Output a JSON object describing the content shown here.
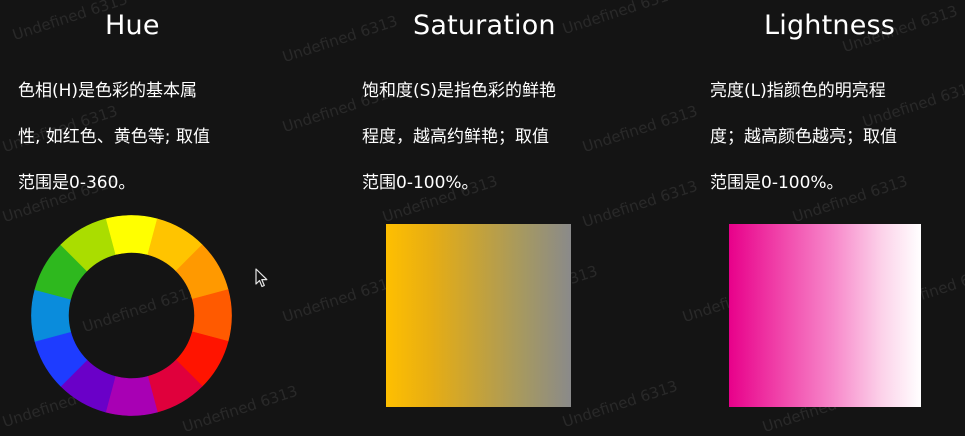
{
  "columns": {
    "hue": {
      "title": "Hue",
      "lines": [
        "色相(H)是色彩的基本属",
        "性, 如红色、黄色等; 取值",
        "范围是0-360。"
      ]
    },
    "saturation": {
      "title": "Saturation",
      "lines": [
        "饱和度(S)是指色彩的鲜艳",
        "程度，越高约鲜艳；取值",
        "范围0-100%。"
      ]
    },
    "lightness": {
      "title": "Lightness",
      "lines": [
        "亮度(L)指颜色的明亮程",
        "度；越高颜色越亮；取值",
        "范围是0-100%。"
      ]
    }
  },
  "hue_wheel": {
    "segment_colors": [
      "#ffff00",
      "#ffc400",
      "#ff9900",
      "#ff5a00",
      "#ff1400",
      "#e0003c",
      "#a800b4",
      "#6a00c8",
      "#1e3cff",
      "#0a8cdc",
      "#2eb81e",
      "#aadd00"
    ]
  },
  "watermark": {
    "text": "Undefined 6313"
  }
}
